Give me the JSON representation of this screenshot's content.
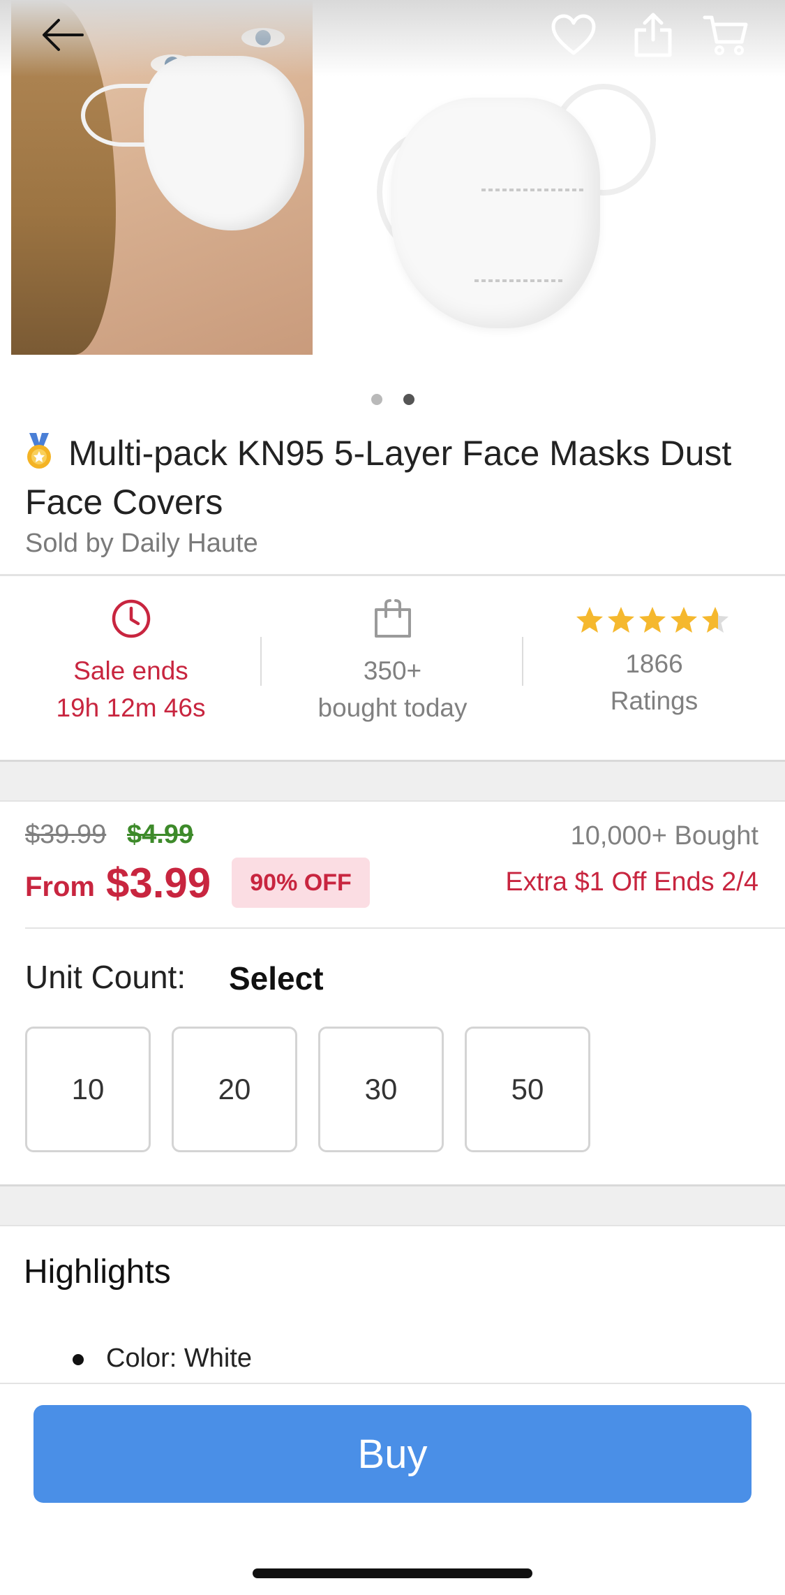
{
  "hero": {
    "slide_count": 2,
    "active_slide": 2
  },
  "product": {
    "title": "Multi-pack KN95 5-Layer Face Masks Dust Face Covers",
    "seller": "Sold by Daily Haute"
  },
  "stats": {
    "sale": {
      "line1": "Sale ends",
      "line2": "19h 12m 46s"
    },
    "bought": {
      "line1": "350+",
      "line2": "bought today"
    },
    "ratings": {
      "stars": 4.5,
      "count": "1866",
      "label": "Ratings"
    }
  },
  "price": {
    "original": "$39.99",
    "was": "$4.99",
    "from_label": "From",
    "current": "$3.99",
    "discount": "90% OFF",
    "bought_total": "10,000+ Bought",
    "promo": "Extra $1 Off Ends 2/4"
  },
  "unit_count": {
    "label": "Unit Count:",
    "selected": "Select",
    "options": [
      "10",
      "20",
      "30",
      "50"
    ]
  },
  "highlights": {
    "title": "Highlights",
    "items": [
      "Color: White"
    ]
  },
  "buy": {
    "label": "Buy"
  },
  "colors": {
    "accent_red": "#c8253f",
    "buy_blue": "#4a8fe7",
    "price_green": "#3d8a2a",
    "star": "#f5b82e"
  }
}
